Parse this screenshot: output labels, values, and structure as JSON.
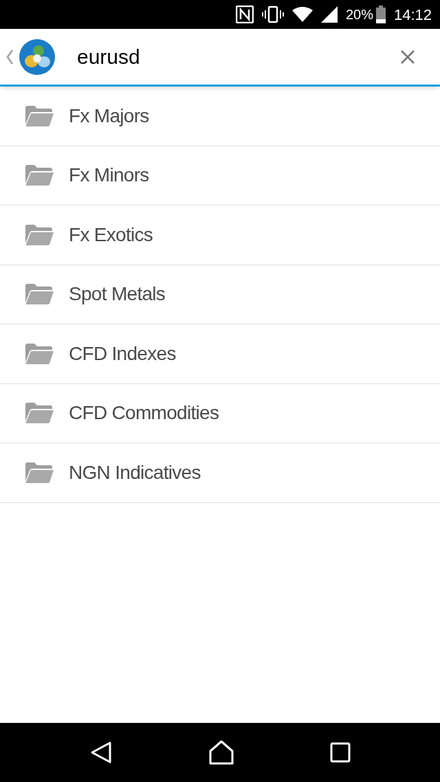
{
  "status_bar": {
    "battery": "20%",
    "time": "14:12"
  },
  "search": {
    "value": "eurusd"
  },
  "folders": [
    {
      "label": "Fx Majors"
    },
    {
      "label": "Fx Minors"
    },
    {
      "label": "Fx Exotics"
    },
    {
      "label": "Spot Metals"
    },
    {
      "label": "CFD Indexes"
    },
    {
      "label": "CFD Commodities"
    },
    {
      "label": "NGN Indicatives"
    }
  ]
}
